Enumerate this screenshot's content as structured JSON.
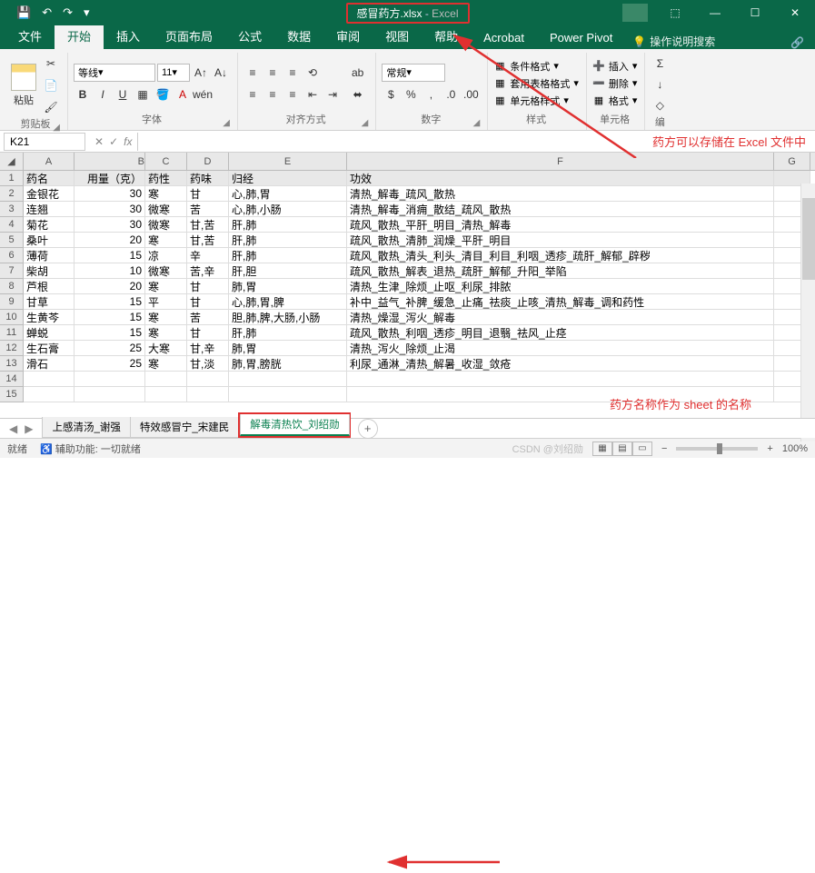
{
  "title": {
    "filename": "感冒药方.xlsx",
    "sep": " - ",
    "app": "Excel"
  },
  "qat": {
    "save": "💾",
    "undo": "↶",
    "redo": "↷",
    "more": "▾"
  },
  "win": {
    "min": "—",
    "restore": "🗗",
    "max": "☐",
    "close": "✕",
    "ribbon_opts": "⬚"
  },
  "tabs": [
    "文件",
    "开始",
    "插入",
    "页面布局",
    "公式",
    "数据",
    "审阅",
    "视图",
    "帮助",
    "Acrobat",
    "Power Pivot"
  ],
  "search_hint": "操作说明搜索",
  "share": "🔗",
  "ribbon": {
    "paste": "粘贴",
    "clipboard": "剪贴板",
    "font_name": "等线",
    "font_size": "11",
    "font_group": "字体",
    "align_group": "对齐方式",
    "number_format": "常规",
    "number_group": "数字",
    "cond_fmt": "条件格式",
    "table_fmt": "套用表格格式",
    "cell_style": "单元格样式",
    "styles_group": "样式",
    "insert": "插入",
    "delete": "删除",
    "format": "格式",
    "cells_group": "单元格",
    "wrap": "ab",
    "merge": "合并"
  },
  "name_box": "K21",
  "fx_label": "fx",
  "annot1": "药方可以存储在 Excel 文件中",
  "annot2": "药方名称作为 sheet 的名称",
  "columns": [
    "A",
    "B",
    "C",
    "D",
    "E",
    "F",
    "G"
  ],
  "header_row": [
    "药名",
    "用量（克）",
    "药性",
    "药味",
    "归经",
    "功效"
  ],
  "rows": [
    [
      "金银花",
      "30",
      "寒",
      "甘",
      "心,肺,胃",
      "清热_解毒_疏风_散热"
    ],
    [
      "连翘",
      "30",
      "微寒",
      "苦",
      "心,肺,小肠",
      "清热_解毒_消痈_散结_疏风_散热"
    ],
    [
      "菊花",
      "30",
      "微寒",
      "甘,苦",
      "肝,肺",
      "疏风_散热_平肝_明目_清热_解毒"
    ],
    [
      "桑叶",
      "20",
      "寒",
      "甘,苦",
      "肝,肺",
      "疏风_散热_清肺_润燥_平肝_明目"
    ],
    [
      "薄荷",
      "15",
      "凉",
      "辛",
      "肝,肺",
      "疏风_散热_清头_利头_清目_利目_利咽_透疹_疏肝_解郁_辟秽"
    ],
    [
      "柴胡",
      "10",
      "微寒",
      "苦,辛",
      "肝,胆",
      "疏风_散热_解表_退热_疏肝_解郁_升阳_举陷"
    ],
    [
      "芦根",
      "20",
      "寒",
      "甘",
      "肺,胃",
      "清热_生津_除烦_止呕_利尿_排脓"
    ],
    [
      "甘草",
      "15",
      "平",
      "甘",
      "心,肺,胃,脾",
      "补中_益气_补脾_缓急_止痛_祛痰_止咳_清热_解毒_调和药性"
    ],
    [
      "生黄芩",
      "15",
      "寒",
      "苦",
      "胆,肺,脾,大肠,小肠",
      "清热_燥湿_泻火_解毒"
    ],
    [
      "蝉蜕",
      "15",
      "寒",
      "甘",
      "肝,肺",
      "疏风_散热_利咽_透疹_明目_退翳_祛风_止痉"
    ],
    [
      "生石膏",
      "25",
      "大寒",
      "甘,辛",
      "肺,胃",
      "清热_泻火_除烦_止渴"
    ],
    [
      "滑石",
      "25",
      "寒",
      "甘,淡",
      "肺,胃,膀胱",
      "利尿_通淋_清热_解暑_收湿_敛疮"
    ]
  ],
  "sheets": [
    "上感清汤_谢强",
    "特效感冒宁_宋建民",
    "解毒清热饮_刘绍勋"
  ],
  "sheet_add": "+",
  "status": {
    "ready": "就绪",
    "acc": "辅助功能: 一切就绪",
    "zoom": "100%",
    "watermark": "CSDN @刘绍勋"
  }
}
